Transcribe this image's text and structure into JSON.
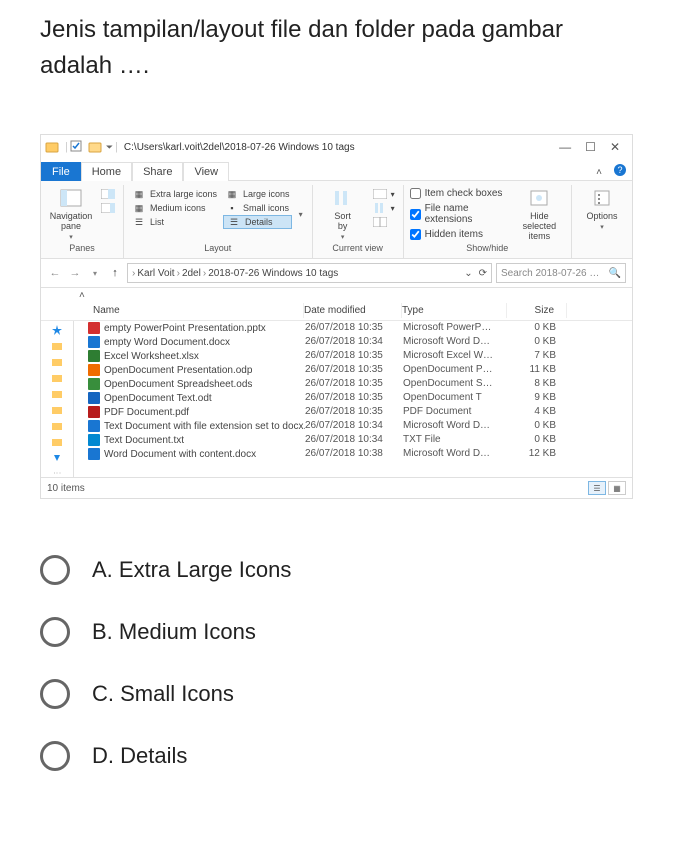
{
  "question": "Jenis tampilan/layout file dan folder pada gambar adalah ….",
  "titlebar": {
    "path": "C:\\Users\\karl.voit\\2del\\2018-07-26 Windows 10 tags"
  },
  "tabs": {
    "file": "File",
    "home": "Home",
    "share": "Share",
    "view": "View"
  },
  "ribbon": {
    "panes": {
      "nav": "Navigation\npane",
      "label": "Panes"
    },
    "layout": {
      "xl": "Extra large icons",
      "large": "Large icons",
      "medium": "Medium icons",
      "small": "Small icons",
      "list": "List",
      "details": "Details",
      "label": "Layout"
    },
    "current_view": {
      "sort": "Sort\nby",
      "label": "Current view"
    },
    "show_hide": {
      "item_check": "Item check boxes",
      "file_ext": "File name extensions",
      "hidden": "Hidden items",
      "hide_sel": "Hide selected\nitems",
      "label": "Show/hide"
    },
    "options": {
      "options": "Options"
    }
  },
  "breadcrumb": {
    "p1": "Karl Voit",
    "p2": "2del",
    "p3": "2018-07-26 Windows 10 tags"
  },
  "search_placeholder": "Search 2018-07-26 …",
  "columns": {
    "name": "Name",
    "date": "Date modified",
    "type": "Type",
    "size": "Size"
  },
  "files": [
    {
      "icon": "#d32f2f",
      "name": "empty PowerPoint Presentation.pptx",
      "date": "26/07/2018 10:35",
      "type": "Microsoft PowerP…",
      "size": "0 KB"
    },
    {
      "icon": "#1976d2",
      "name": "empty Word Document.docx",
      "date": "26/07/2018 10:34",
      "type": "Microsoft Word D…",
      "size": "0 KB"
    },
    {
      "icon": "#2e7d32",
      "name": "Excel Worksheet.xlsx",
      "date": "26/07/2018 10:35",
      "type": "Microsoft Excel W…",
      "size": "7 KB"
    },
    {
      "icon": "#ef6c00",
      "name": "OpenDocument Presentation.odp",
      "date": "26/07/2018 10:35",
      "type": "OpenDocument P…",
      "size": "11 KB"
    },
    {
      "icon": "#388e3c",
      "name": "OpenDocument Spreadsheet.ods",
      "date": "26/07/2018 10:35",
      "type": "OpenDocument S…",
      "size": "8 KB"
    },
    {
      "icon": "#1565c0",
      "name": "OpenDocument Text.odt",
      "date": "26/07/2018 10:35",
      "type": "OpenDocument T",
      "size": "9 KB"
    },
    {
      "icon": "#b71c1c",
      "name": "PDF Document.pdf",
      "date": "26/07/2018 10:35",
      "type": "PDF Document",
      "size": "4 KB"
    },
    {
      "icon": "#1976d2",
      "name": "Text Document with file extension set to docx.docx",
      "date": "26/07/2018 10:34",
      "type": "Microsoft Word D…",
      "size": "0 KB"
    },
    {
      "icon": "#0288d1",
      "name": "Text Document.txt",
      "date": "26/07/2018 10:34",
      "type": "TXT File",
      "size": "0 KB"
    },
    {
      "icon": "#1976d2",
      "name": "Word Document with content.docx",
      "date": "26/07/2018 10:38",
      "type": "Microsoft Word D…",
      "size": "12 KB"
    }
  ],
  "status": {
    "count": "10 items"
  },
  "answers": {
    "a": "A. Extra Large Icons",
    "b": "B. Medium Icons",
    "c": "C. Small Icons",
    "d": "D. Details"
  }
}
